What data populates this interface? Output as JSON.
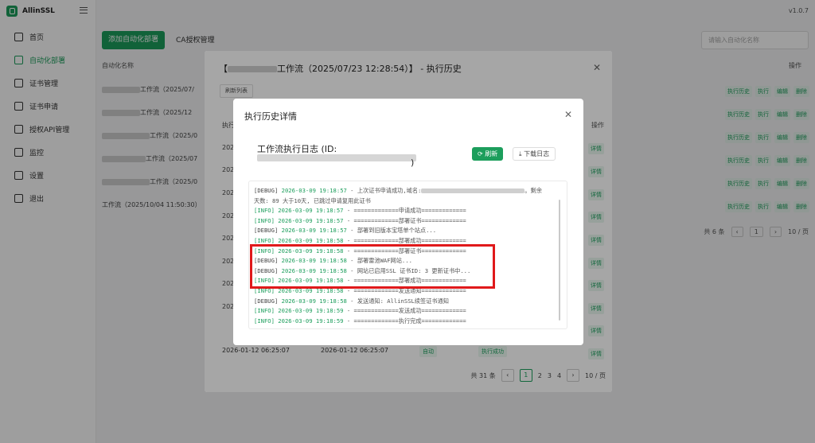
{
  "app": {
    "name": "AllinSSL",
    "version": "v1.0.7"
  },
  "sidebar": {
    "items": [
      {
        "label": "首页"
      },
      {
        "label": "自动化部署"
      },
      {
        "label": "证书管理"
      },
      {
        "label": "证书申请"
      },
      {
        "label": "授权API管理"
      },
      {
        "label": "监控"
      },
      {
        "label": "设置"
      },
      {
        "label": "退出"
      }
    ]
  },
  "toolbar": {
    "add_button": "添加自动化部署",
    "ca_tab": "CA授权管理",
    "search_placeholder": "请输入自动化名称"
  },
  "table": {
    "col_name": "自动化名称",
    "col_status": "状态",
    "col_ops": "操作",
    "rows": [
      {
        "name": "工作流（2025/07/"
      },
      {
        "name": "工作流（2025/12"
      },
      {
        "name": "工作流（2025/0"
      },
      {
        "name": "工作流（2025/07"
      },
      {
        "name": "工作流（2025/0"
      },
      {
        "name": "工作流（2025/10/04 11:50:30）"
      }
    ],
    "row_actions": [
      "执行历史",
      "执行",
      "编辑",
      "删除"
    ],
    "total": "共 6 条",
    "page": "1",
    "page_size": "10 / 页"
  },
  "history_modal": {
    "title_prefix": "【",
    "title": "工作流（2025/07/23 12:28:54）】 - 执行历史",
    "refresh": "刷新列表",
    "col_exec": "执行",
    "col_ops": "操作",
    "rows_prefix": [
      "202",
      "202",
      "202",
      "202",
      "202",
      "202",
      "202",
      "202",
      "202",
      "202"
    ],
    "detail_label": "详情",
    "bottom_row": {
      "start": "2026-01-12 06:25:07",
      "end": "2026-01-12 06:25:07",
      "mode": "自动",
      "status": "执行成功"
    },
    "pager": {
      "total": "共 31 条",
      "pages": [
        "1",
        "2",
        "3",
        "4"
      ],
      "current": "1",
      "page_size": "10 / 页"
    }
  },
  "detail_modal": {
    "title": "执行历史详情",
    "log_title": "工作流执行日志 (ID:",
    "log_title_end": ")",
    "refresh_button": "刷新",
    "download_button": "下载日志",
    "logs": [
      {
        "level": "[DEBUG]",
        "ts": "2026-03-09 19:18:57",
        "msg": " - 上次证书申请成功,域名:"
      },
      {
        "level": "",
        "ts": "",
        "msg": "天数: 89 大于10天, 已跳过申请复用此证书"
      },
      {
        "level": "[INFO]",
        "ts": "2026-03-09 19:18:57",
        "msg": " - =============申请成功============="
      },
      {
        "level": "[INFO]",
        "ts": "2026-03-09 19:18:57",
        "msg": " - =============部署证书============="
      },
      {
        "level": "[DEBUG]",
        "ts": "2026-03-09 19:18:57",
        "msg": " - 部署到旧版本宝塔单个站点..."
      },
      {
        "level": "[INFO]",
        "ts": "2026-03-09 19:18:58",
        "msg": " - =============部署成功============="
      },
      {
        "level": "[INFO]",
        "ts": "2026-03-09 19:18:58",
        "msg": " - =============部署证书============="
      },
      {
        "level": "[DEBUG]",
        "ts": "2026-03-09 19:18:58",
        "msg": " - 部署雷池WAF网站..."
      },
      {
        "level": "[DEBUG]",
        "ts": "2026-03-09 19:18:58",
        "msg": " - 网站已启用SSL 证书ID: 3 更新证书中..."
      },
      {
        "level": "[INFO]",
        "ts": "2026-03-09 19:18:58",
        "msg": " - =============部署成功============="
      },
      {
        "level": "[INFO]",
        "ts": "2026-03-09 19:18:58",
        "msg": " - =============发送通知============="
      },
      {
        "level": "[DEBUG]",
        "ts": "2026-03-09 19:18:58",
        "msg": " - 发送通知: AllinSSL续签证书通知"
      },
      {
        "level": "[INFO]",
        "ts": "2026-03-09 19:18:59",
        "msg": " - =============发送成功============="
      },
      {
        "level": "[INFO]",
        "ts": "2026-03-09 19:18:59",
        "msg": " - =============执行完成============="
      }
    ],
    "first_line_suffix": "。剩余"
  },
  "colors": {
    "accent": "#1c9e5c",
    "highlight": "#e0191b"
  }
}
